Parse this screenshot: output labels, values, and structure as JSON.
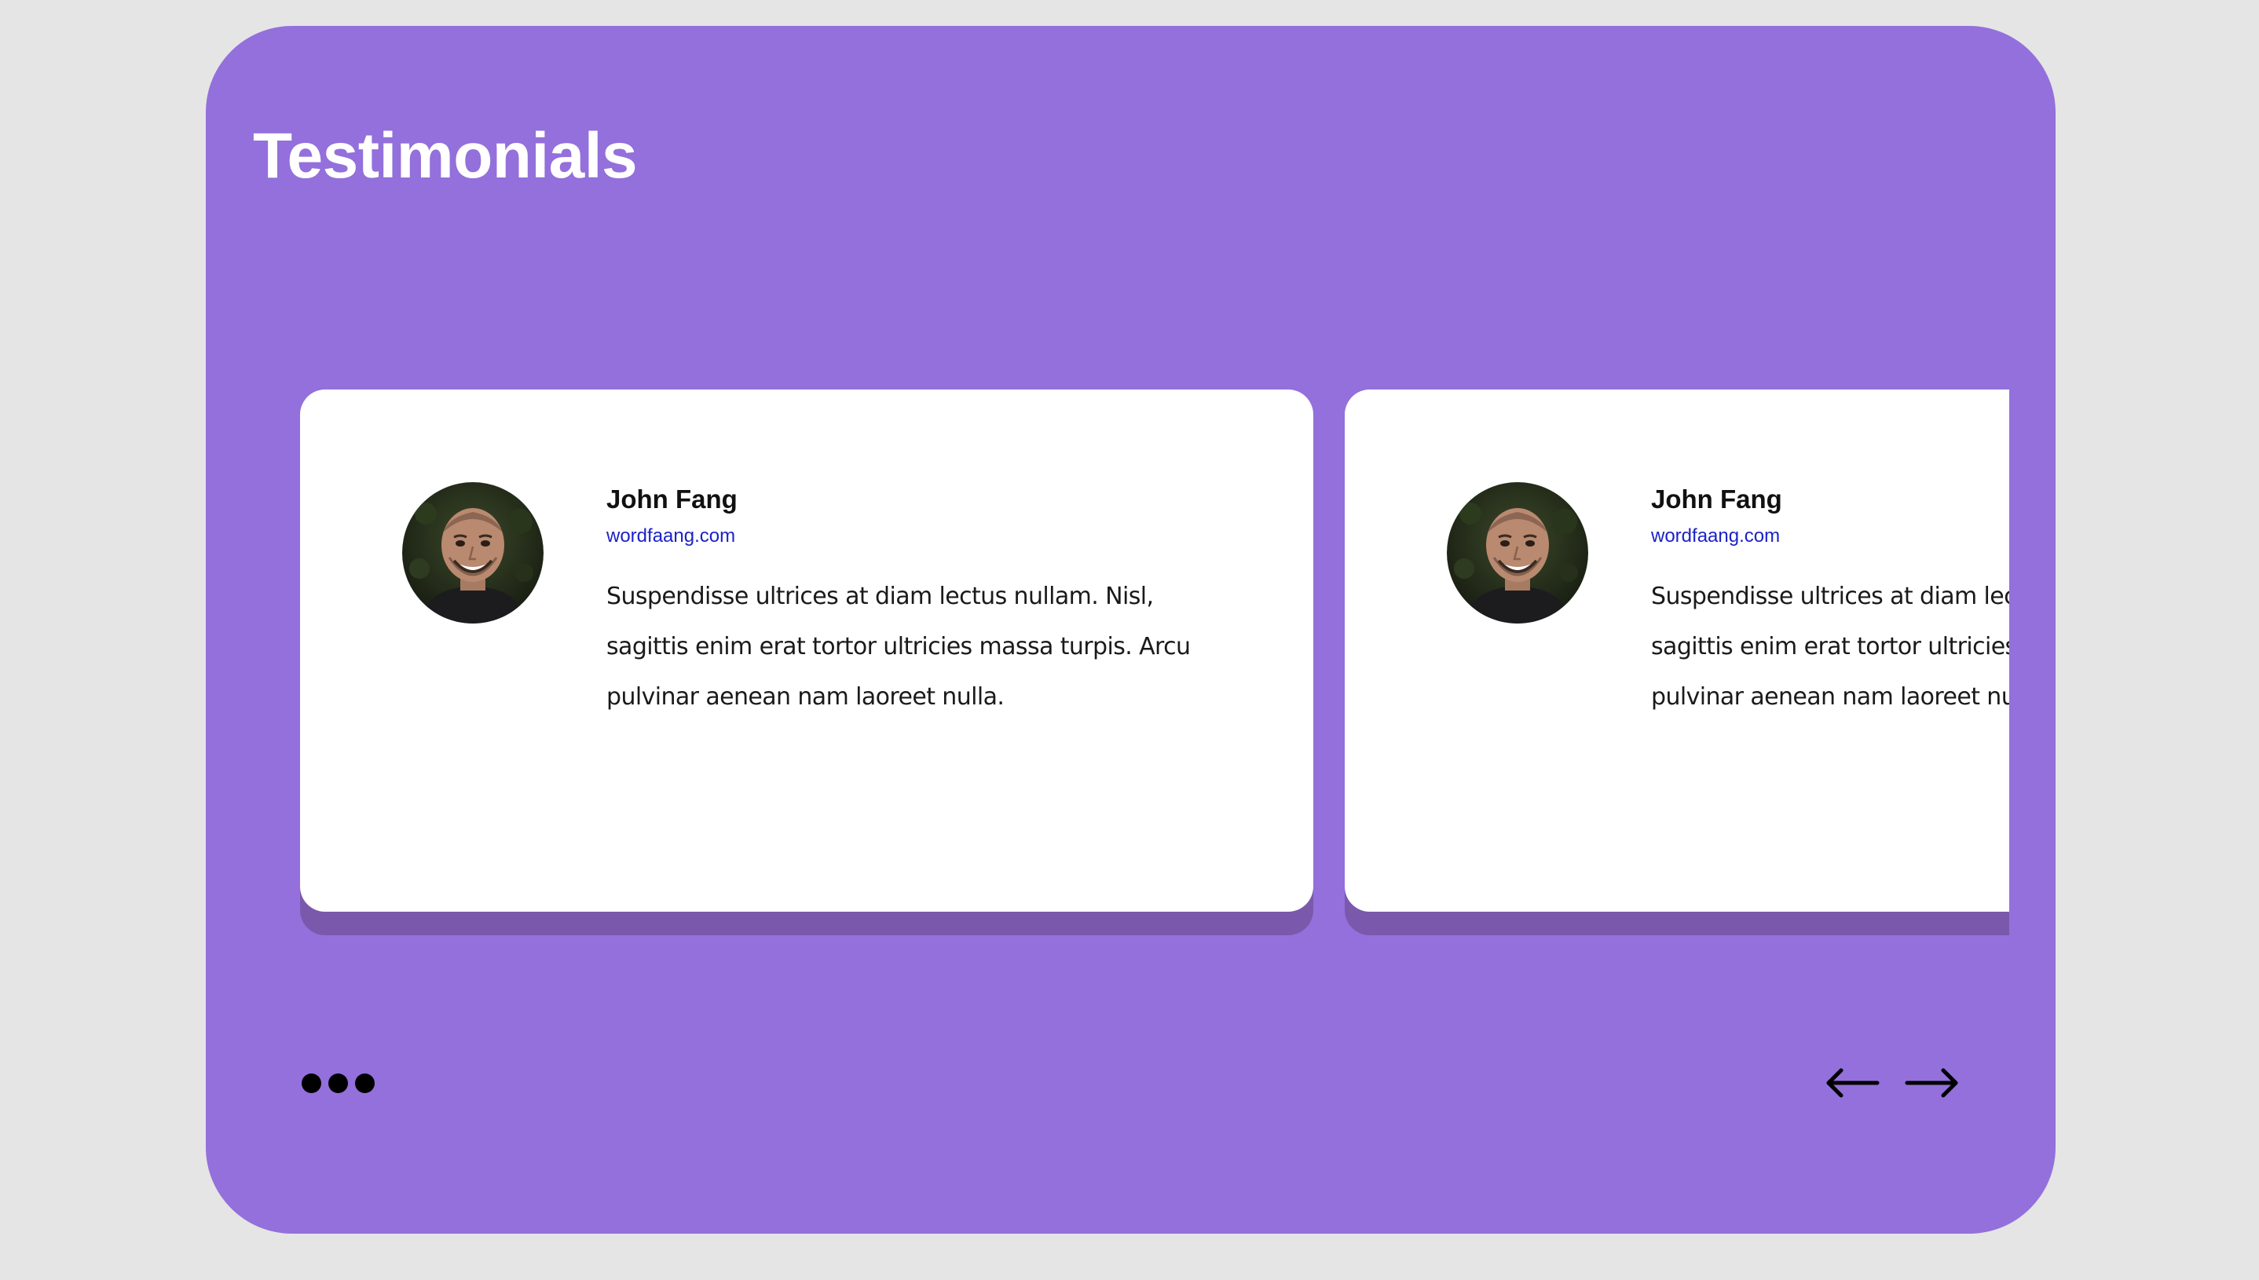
{
  "section": {
    "title": "Testimonials"
  },
  "testimonials": [
    {
      "name": "John Fang",
      "website": "wordfaang.com",
      "quote": "Suspendisse ultrices at diam lectus nullam. Nisl, sagittis enim erat tortor ultricies massa turpis. Arcu pulvinar aenean nam laoreet nulla."
    },
    {
      "name": "John Fang",
      "website": "wordfaang.com",
      "quote": "Suspendisse ultrices at diam lectus nullam. Nisl, sagittis enim erat tortor ultricies massa turpis. Arcu pulvinar aenean nam laoreet nulla."
    }
  ],
  "pagination": {
    "dot_count": 3
  },
  "navigation": {
    "prev_icon": "arrow-left-icon",
    "next_icon": "arrow-right-icon"
  },
  "colors": {
    "background": "#e5e5e5",
    "panel": "#9370db",
    "card": "#ffffff",
    "card_shadow": "#7a59ad",
    "link": "#1a22c8"
  }
}
